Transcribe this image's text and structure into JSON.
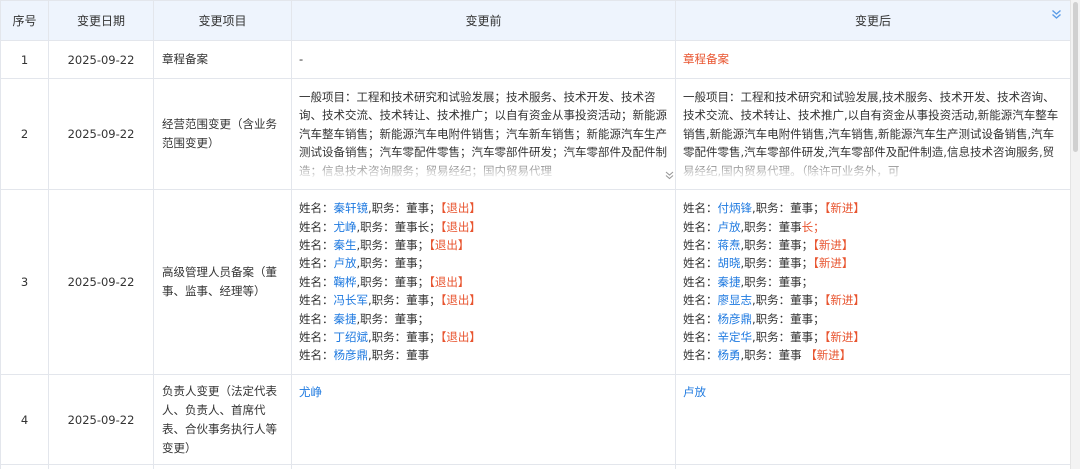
{
  "columns": [
    "序号",
    "变更日期",
    "变更项目",
    "变更前",
    "变更后"
  ],
  "icons": {
    "header_expand": "double-chevron-down-icon",
    "cell_more": "double-chevron-down-icon"
  },
  "colors": {
    "link": "#1f7ae0",
    "highlight": "#e8542f",
    "header_bg": "#eef4fd"
  },
  "rows": [
    {
      "num": "1",
      "date": "2025-09-22",
      "item": "章程备案",
      "before": "-",
      "after": "章程备案"
    },
    {
      "num": "2",
      "date": "2025-09-22",
      "item": "经营范围变更（含业务范围变更）",
      "before": "一般项目：工程和技术研究和试验发展；技术服务、技术开发、技术咨询、技术交流、技术转让、技术推广；以自有资金从事投资活动；新能源汽车整车销售；新能源汽车电附件销售；汽车新车销售；新能源汽车生产测试设备销售；汽车零配件零售；汽车零部件研发；汽车零部件及配件制造；信息技术咨询服务；贸易经纪；国内贸易代理",
      "after": "一般项目：工程和技术研究和试验发展,技术服务、技术开发、技术咨询、技术交流、技术转让、技术推广,以自有资金从事投资活动,新能源汽车整车销售,新能源汽车电附件销售,汽车销售,新能源汽车生产测试设备销售,汽车零配件零售,汽车零部件研发,汽车零部件及配件制造,信息技术咨询服务,贸易经纪,国内贸易代理。（除许可业务外，可"
    },
    {
      "num": "3",
      "date": "2025-09-22",
      "item": "高级管理人员备案（董事、监事、经理等）",
      "before_people": [
        {
          "prefix": "姓名：",
          "name": "秦轩镜",
          "role": ",职务：董事",
          "sep": "；",
          "tag": "【退出】"
        },
        {
          "prefix": "姓名：",
          "name": "尤峥",
          "role": ",职务：董事长",
          "sep": "；",
          "tag": "【退出】"
        },
        {
          "prefix": "姓名：",
          "name": "秦生",
          "role": ",职务：董事",
          "sep": "；",
          "tag": "【退出】"
        },
        {
          "prefix": "姓名：",
          "name": "卢放",
          "role": ",职务：董事",
          "sep": "；",
          "tag": ""
        },
        {
          "prefix": "姓名：",
          "name": "鞠桦",
          "role": ",职务：董事",
          "sep": "；",
          "tag": "【退出】"
        },
        {
          "prefix": "姓名：",
          "name": "冯长军",
          "role": ",职务：董事",
          "sep": "；",
          "tag": "【退出】"
        },
        {
          "prefix": "姓名：",
          "name": "秦捷",
          "role": ",职务：董事",
          "sep": "；",
          "tag": ""
        },
        {
          "prefix": "姓名：",
          "name": "丁绍斌",
          "role": ",职务：董事",
          "sep": "；",
          "tag": "【退出】"
        },
        {
          "prefix": "姓名：",
          "name": "杨彦鼎",
          "role": ",职务：董事",
          "sep": "",
          "tag": ""
        }
      ],
      "after_people": [
        {
          "prefix": "姓名：",
          "name": "付炳锋",
          "role": ",职务：董事",
          "sep": "；",
          "tag": "【新进】"
        },
        {
          "prefix": "姓名：",
          "name": "卢放",
          "role": ",职务：董事",
          "sep": "",
          "tag": "长；"
        },
        {
          "prefix": "姓名：",
          "name": "蒋焘",
          "role": ",职务：董事",
          "sep": "；",
          "tag": "【新进】"
        },
        {
          "prefix": "姓名：",
          "name": "胡晓",
          "role": ",职务：董事",
          "sep": "；",
          "tag": "【新进】"
        },
        {
          "prefix": "姓名：",
          "name": "秦捷",
          "role": ",职务：董事",
          "sep": "；",
          "tag": ""
        },
        {
          "prefix": "姓名：",
          "name": "廖显志",
          "role": ",职务：董事",
          "sep": "；",
          "tag": "【新进】"
        },
        {
          "prefix": "姓名：",
          "name": "杨彦鼎",
          "role": ",职务：董事",
          "sep": "；",
          "tag": ""
        },
        {
          "prefix": "姓名：",
          "name": "辛定华",
          "role": ",职务：董事",
          "sep": "；",
          "tag": "【新进】"
        },
        {
          "prefix": "姓名：",
          "name": "杨勇",
          "role": ",职务：董事",
          "sep": " ",
          "tag": "【新进】"
        }
      ]
    },
    {
      "num": "4",
      "date": "2025-09-22",
      "item": "负责人变更（法定代表人、负责人、首席代表、合伙事务执行人等变更）",
      "before": "尤峥",
      "after": "卢放"
    }
  ]
}
